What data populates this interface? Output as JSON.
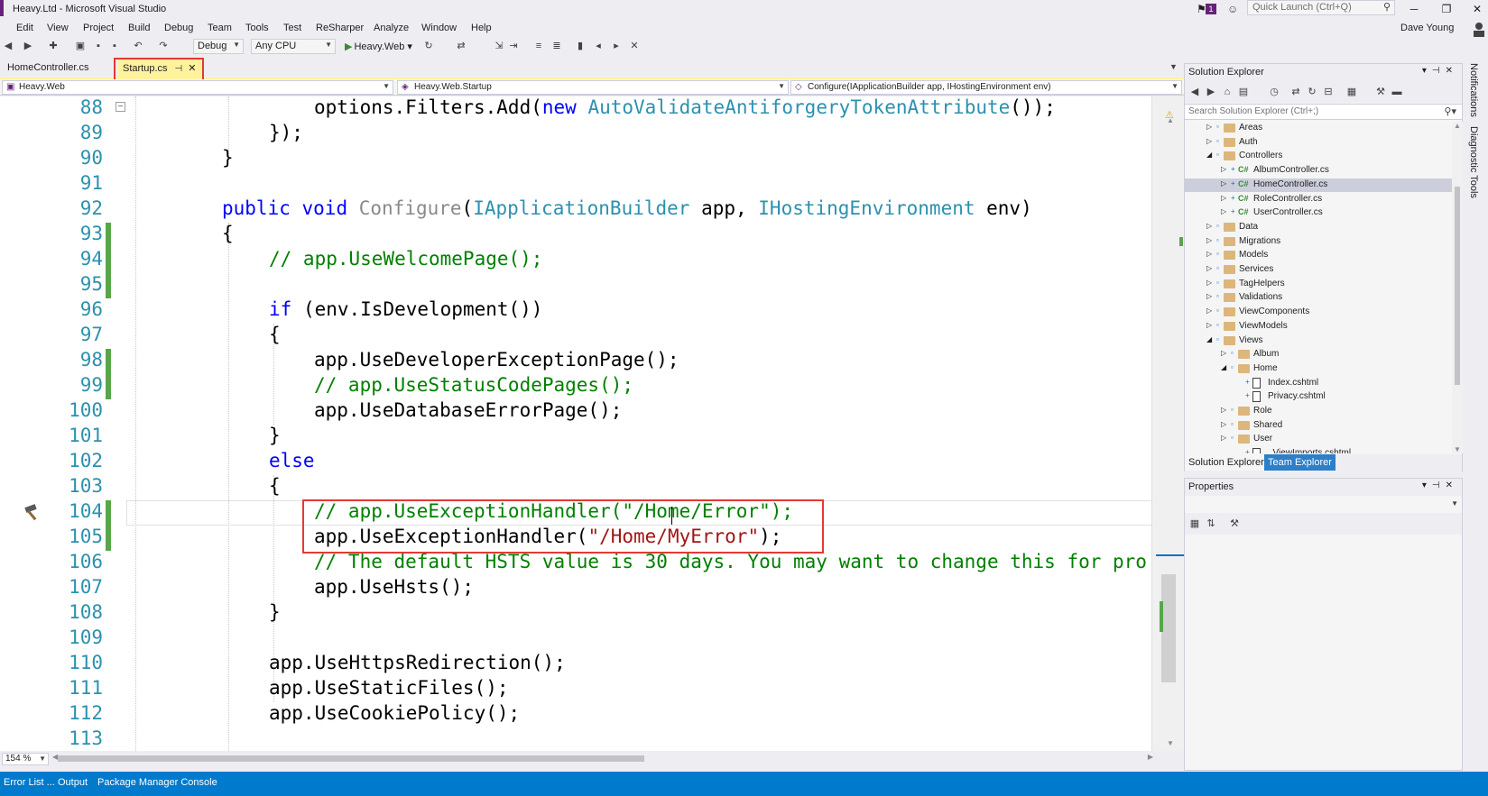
{
  "window": {
    "title": "Heavy.Ltd - Microsoft Visual Studio",
    "notification_count": "1",
    "quick_launch_placeholder": "Quick Launch (Ctrl+Q)",
    "user": "Dave Young"
  },
  "menu": [
    "Edit",
    "View",
    "Project",
    "Build",
    "Debug",
    "Team",
    "Tools",
    "Test",
    "ReSharper",
    "Analyze",
    "Window",
    "Help"
  ],
  "toolbar": {
    "configuration": "Debug",
    "platform": "Any CPU",
    "run_target": "Heavy.Web"
  },
  "tabs": [
    {
      "label": "HomeController.cs",
      "active": false
    },
    {
      "label": "Startup.cs",
      "active": true
    }
  ],
  "navbar": {
    "project": "Heavy.Web",
    "type": "Heavy.Web.Startup",
    "member": "Configure(IApplicationBuilder app, IHostingEnvironment env)"
  },
  "editor": {
    "zoom": "154 %",
    "lines": [
      {
        "n": "88",
        "changed": false
      },
      {
        "n": "89",
        "changed": false
      },
      {
        "n": "90",
        "changed": false
      },
      {
        "n": "91",
        "changed": false
      },
      {
        "n": "92",
        "changed": false
      },
      {
        "n": "93",
        "changed": true
      },
      {
        "n": "94",
        "changed": true
      },
      {
        "n": "95",
        "changed": true
      },
      {
        "n": "96",
        "changed": false
      },
      {
        "n": "97",
        "changed": false
      },
      {
        "n": "98",
        "changed": true
      },
      {
        "n": "99",
        "changed": true
      },
      {
        "n": "100",
        "changed": false
      },
      {
        "n": "101",
        "changed": false
      },
      {
        "n": "102",
        "changed": false
      },
      {
        "n": "103",
        "changed": false
      },
      {
        "n": "104",
        "changed": true
      },
      {
        "n": "105",
        "changed": true
      },
      {
        "n": "106",
        "changed": false
      },
      {
        "n": "107",
        "changed": false
      },
      {
        "n": "108",
        "changed": false
      },
      {
        "n": "109",
        "changed": false
      },
      {
        "n": "110",
        "changed": false
      },
      {
        "n": "111",
        "changed": false
      },
      {
        "n": "112",
        "changed": false
      },
      {
        "n": "113",
        "changed": false
      }
    ],
    "code": {
      "l88_a": "options.Filters.Add(",
      "l88_kw": "new",
      "l88_ty": "AutoValidateAntiforgeryTokenAttribute",
      "l88_b": "());",
      "l89": "});",
      "l90": "}",
      "l92_kw1": "public",
      "l92_kw2": "void",
      "l92_name": "Configure",
      "l92_p1": "(",
      "l92_ty1": "IApplicationBuilder",
      "l92_p2": " app, ",
      "l92_ty2": "IHostingEnvironment",
      "l92_p3": " env)",
      "l93": "{",
      "l94": "// app.UseWelcomePage();",
      "l96_kw": "if",
      "l96_rest": " (env.IsDevelopment())",
      "l97": "{",
      "l98": "app.UseDeveloperExceptionPage();",
      "l99": "// app.UseStatusCodePages();",
      "l100": "app.UseDatabaseErrorPage();",
      "l101": "}",
      "l102": "else",
      "l103": "{",
      "l104": "// app.UseExceptionHandler(\"/Home/Error\");",
      "l105_a": "app.UseExceptionHandler(",
      "l105_str": "\"/Home/MyError\"",
      "l105_b": ");",
      "l106": "// The default HSTS value is 30 days. You may want to change this for pro",
      "l107": "app.UseHsts();",
      "l108": "}",
      "l110": "app.UseHttpsRedirection();",
      "l111": "app.UseStaticFiles();",
      "l112": "app.UseCookiePolicy();"
    }
  },
  "solution_explorer": {
    "title": "Solution Explorer",
    "search_placeholder": "Search Solution Explorer (Ctrl+;)",
    "items": [
      {
        "label": "Areas",
        "kind": "folder",
        "level": 0,
        "expander": "collapsed"
      },
      {
        "label": "Auth",
        "kind": "folder",
        "level": 0,
        "expander": "collapsed"
      },
      {
        "label": "Controllers",
        "kind": "folder",
        "level": 0,
        "expander": "expanded"
      },
      {
        "label": "AlbumController.cs",
        "kind": "cs",
        "level": 1,
        "expander": "collapsed"
      },
      {
        "label": "HomeController.cs",
        "kind": "cs",
        "level": 1,
        "expander": "collapsed",
        "selected": true
      },
      {
        "label": "RoleController.cs",
        "kind": "cs",
        "level": 1,
        "expander": "collapsed"
      },
      {
        "label": "UserController.cs",
        "kind": "cs",
        "level": 1,
        "expander": "collapsed"
      },
      {
        "label": "Data",
        "kind": "folder",
        "level": 0,
        "expander": "collapsed"
      },
      {
        "label": "Migrations",
        "kind": "folder",
        "level": 0,
        "expander": "collapsed"
      },
      {
        "label": "Models",
        "kind": "folder",
        "level": 0,
        "expander": "collapsed"
      },
      {
        "label": "Services",
        "kind": "folder",
        "level": 0,
        "expander": "collapsed"
      },
      {
        "label": "TagHelpers",
        "kind": "folder",
        "level": 0,
        "expander": "collapsed"
      },
      {
        "label": "Validations",
        "kind": "folder",
        "level": 0,
        "expander": "collapsed"
      },
      {
        "label": "ViewComponents",
        "kind": "folder",
        "level": 0,
        "expander": "collapsed"
      },
      {
        "label": "ViewModels",
        "kind": "folder",
        "level": 0,
        "expander": "collapsed"
      },
      {
        "label": "Views",
        "kind": "folder",
        "level": 0,
        "expander": "expanded"
      },
      {
        "label": "Album",
        "kind": "folder",
        "level": 1,
        "expander": "collapsed"
      },
      {
        "label": "Home",
        "kind": "folder",
        "level": 1,
        "expander": "expanded"
      },
      {
        "label": "Index.cshtml",
        "kind": "doc",
        "level": 2,
        "expander": "none"
      },
      {
        "label": "Privacy.cshtml",
        "kind": "doc",
        "level": 2,
        "expander": "none"
      },
      {
        "label": "Role",
        "kind": "folder",
        "level": 1,
        "expander": "collapsed"
      },
      {
        "label": "Shared",
        "kind": "folder",
        "level": 1,
        "expander": "collapsed"
      },
      {
        "label": "User",
        "kind": "folder",
        "level": 1,
        "expander": "collapsed"
      },
      {
        "label": "_ViewImports.cshtml",
        "kind": "doc",
        "level": 2,
        "expander": "none"
      }
    ],
    "tabs": [
      "Solution Explorer",
      "Team Explorer"
    ]
  },
  "properties": {
    "title": "Properties"
  },
  "right_rail": [
    "Notifications",
    "Diagnostic Tools"
  ],
  "bottom_tabs": [
    "Error List ...",
    "Output",
    "Package Manager Console"
  ],
  "colors": {
    "accent": "#007ACC",
    "active_tab": "#FFF29D",
    "highlight_box": "#E53935",
    "change_marker": "#57A64A",
    "vs_purple": "#68217A"
  }
}
